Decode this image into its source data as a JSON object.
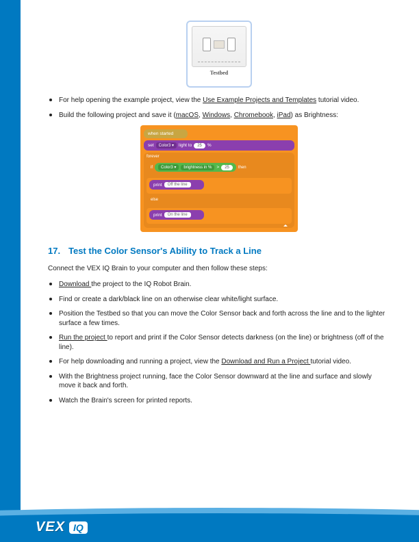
{
  "top_image": {
    "label": "Testbed",
    "alt": "Testbed example project icon"
  },
  "bullets_1": [
    {
      "pre": "For help opening the example project, view the ",
      "link": "Use Example Projects and Templates",
      "post": " tutorial video."
    },
    {
      "pre": "Build the following project and save it (",
      "links": [
        "macOS",
        "Windows",
        "Chromebook",
        "iPad"
      ],
      "post": ") as Brightness:"
    }
  ],
  "code_blocks": {
    "event": "when started",
    "set_line": {
      "label_set": "set",
      "sensor": "Color3 ▾",
      "mid": "light to",
      "value": "25",
      "pct": "%"
    },
    "forever": "forever",
    "if_label": "if",
    "then_label": "then",
    "else_label": "else",
    "cond": {
      "sensor": "Color3 ▾",
      "metric": "brightness in %",
      "op": ">",
      "value": "25"
    },
    "print1": {
      "cmd": "print",
      "text": "Off the line"
    },
    "print2": {
      "cmd": "print",
      "text": "On the line"
    }
  },
  "section": {
    "num": "17.",
    "title": "Test the Color Sensor's Ability to Track a Line"
  },
  "intro": "Connect the VEX IQ Brain to your computer and then follow these steps:",
  "bullets_2": [
    {
      "link": "Download ",
      "post": "the project to the IQ Robot Brain."
    },
    {
      "plain": "Find or create a dark/black line on an otherwise clear white/light surface."
    },
    {
      "plain": "Position the Testbed so that you can move the Color Sensor back and forth across the line and to the lighter surface a few times."
    },
    {
      "link": "Run the project ",
      "post": "to report and print if the Color Sensor detects darkness (on the line) or brightness (off of the line)."
    },
    {
      "pre": "For help downloading and running a project, view the ",
      "link": "Download and Run a Project ",
      "post": "tutorial video."
    },
    {
      "plain": "With the Brightness project running, face the Color Sensor downward at the line and surface and slowly move it back and forth."
    },
    {
      "plain": "Watch the Brain's screen for printed reports."
    }
  ],
  "footer": {
    "brand": "VEX",
    "sub": "IQ"
  }
}
